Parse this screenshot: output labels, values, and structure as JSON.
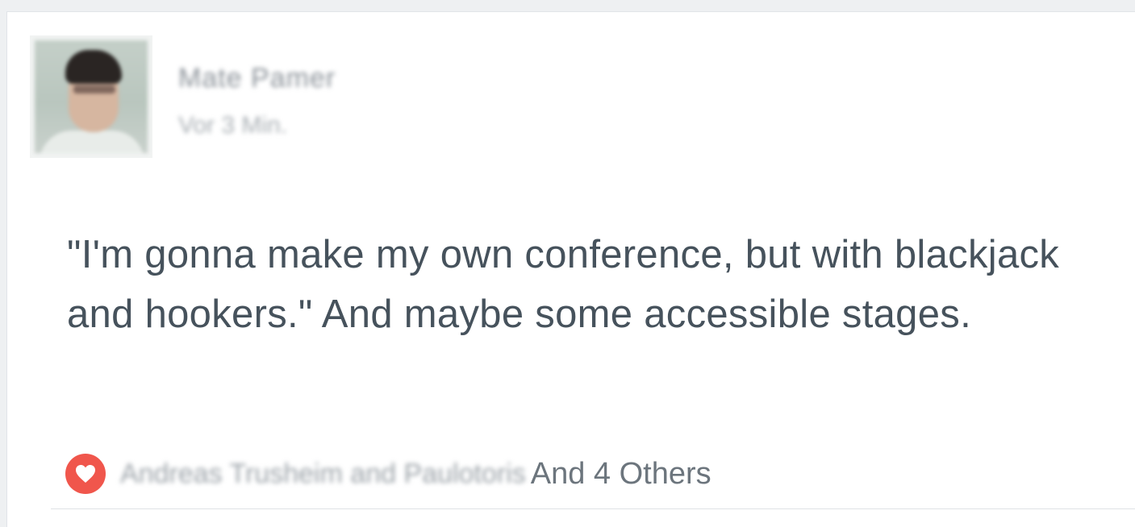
{
  "post": {
    "author_name": "Mate Pamer",
    "timestamp": "Vor 3 Min.",
    "text": "\"I'm gonna make my own conference, but with blackjack and hookers.\" And maybe some accessible stages.",
    "likes": {
      "icon": "heart-icon",
      "icon_color": "#f0564c",
      "likers": "Andreas Trusheim and Paulotoris",
      "others_label": "And 4 Others"
    }
  }
}
